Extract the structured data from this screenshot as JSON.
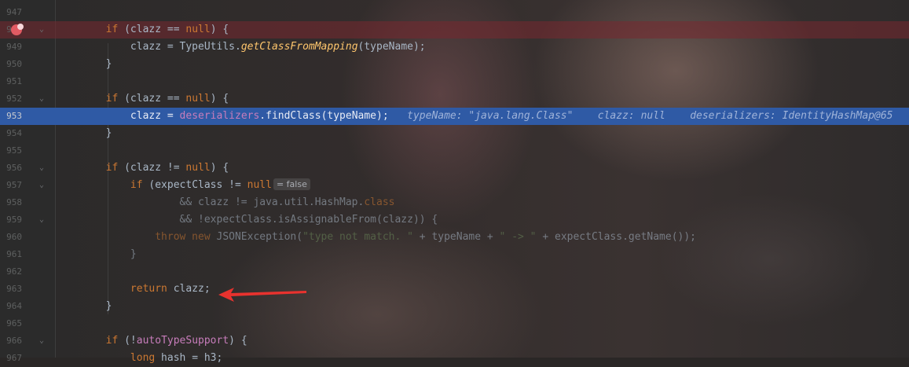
{
  "editor": {
    "lines": [
      {
        "num": "947",
        "code": ""
      },
      {
        "num": "948",
        "code": "        if (clazz == null) {"
      },
      {
        "num": "949",
        "code": "            clazz = TypeUtils.getClassFromMapping(typeName);"
      },
      {
        "num": "950",
        "code": "        }"
      },
      {
        "num": "951",
        "code": ""
      },
      {
        "num": "952",
        "code": "        if (clazz == null) {"
      },
      {
        "num": "953",
        "code": "            clazz = deserializers.findClass(typeName);"
      },
      {
        "num": "954",
        "code": "        }"
      },
      {
        "num": "955",
        "code": ""
      },
      {
        "num": "956",
        "code": "        if (clazz != null) {"
      },
      {
        "num": "957",
        "code": "            if (expectClass != null"
      },
      {
        "num": "958",
        "code": "                    && clazz != java.util.HashMap.class"
      },
      {
        "num": "959",
        "code": "                    && !expectClass.isAssignableFrom(clazz)) {"
      },
      {
        "num": "960",
        "code": "                throw new JSONException(\"type not match. \" + typeName + \" -> \" + expectClass.getName());"
      },
      {
        "num": "961",
        "code": "            }"
      },
      {
        "num": "962",
        "code": ""
      },
      {
        "num": "963",
        "code": "            return clazz;"
      },
      {
        "num": "964",
        "code": "        }"
      },
      {
        "num": "965",
        "code": ""
      },
      {
        "num": "966",
        "code": "        if (!autoTypeSupport) {"
      },
      {
        "num": "967",
        "code": "            long hash = h3;"
      }
    ],
    "inline_hint": "= false",
    "debug_values": {
      "typeName": "typeName: \"java.lang.Class\"",
      "clazz": "clazz: null",
      "deserializers": "deserializers: IdentityHashMap@65"
    }
  },
  "colors": {
    "breakpoint": "#e15b63",
    "execution_line": "#2f5aa5",
    "keyword": "#cc7832",
    "field": "#c77dbb",
    "string": "#6a8759",
    "arrow": "#e8322e"
  },
  "icons": {
    "breakpoint": "breakpoint-icon",
    "fold": "fold-chevron-icon",
    "annotation_arrow": "red-arrow-icon"
  }
}
